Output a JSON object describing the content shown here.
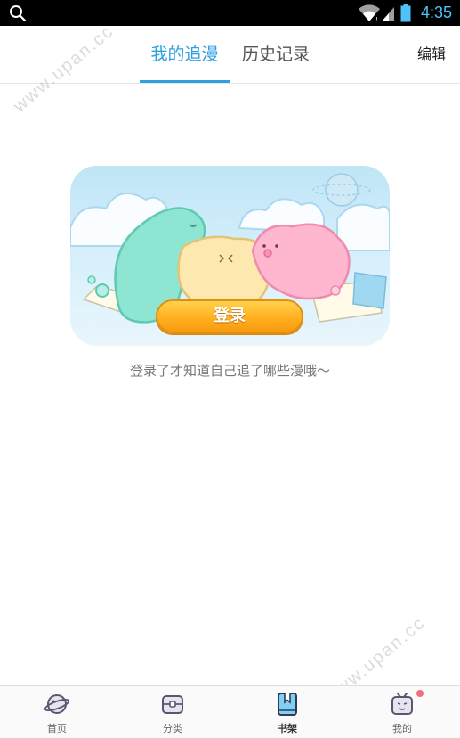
{
  "status_bar": {
    "time": "4:35",
    "icons": [
      "search-icon",
      "wifi-icon",
      "signal-icon",
      "battery-icon"
    ]
  },
  "header": {
    "tabs": [
      {
        "label": "我的追漫",
        "active": true
      },
      {
        "label": "历史记录",
        "active": false
      }
    ],
    "edit_label": "编辑"
  },
  "main": {
    "login_button": "登录",
    "hint": "登录了才知道自己追了哪些漫哦～"
  },
  "watermarks": [
    "www.upan.cc",
    "www.upan.cc"
  ],
  "bottom_nav": {
    "items": [
      {
        "label": "首页",
        "icon": "planet-icon",
        "active": false
      },
      {
        "label": "分类",
        "icon": "category-box-icon",
        "active": false
      },
      {
        "label": "书架",
        "icon": "bookshelf-icon",
        "active": true
      },
      {
        "label": "我的",
        "icon": "tv-face-icon",
        "active": false,
        "badge": true
      }
    ]
  },
  "colors": {
    "accent": "#2fa0e0",
    "status_time": "#4fc3f7",
    "login_button": "#ffb01f",
    "badge": "#f26d7d"
  }
}
